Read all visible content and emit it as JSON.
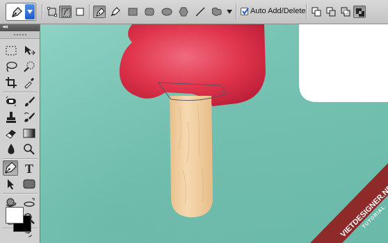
{
  "options_bar": {
    "tool_preset_icon": "pen-icon",
    "tool_icons": [
      "shape-layers-icon",
      "paths-icon",
      "fill-pixels-icon",
      "pen-icon",
      "freeform-pen-icon",
      "rectangle-icon",
      "rounded-rectangle-icon",
      "ellipse-icon",
      "polygon-icon",
      "line-icon",
      "custom-shape-icon",
      "dropdown-arrow-icon"
    ],
    "auto_add_delete": {
      "label": "Auto Add/Delete",
      "checked": true
    },
    "path_mode_icons": [
      "add-to-path-icon",
      "subtract-from-path-icon",
      "intersect-path-icon",
      "exclude-overlap-icon"
    ]
  },
  "toolbox": {
    "header_glyph": "◂◂",
    "tools": [
      "marquee-icon",
      "move-icon",
      "lasso-icon",
      "quick-selection-icon",
      "crop-icon",
      "eyedropper-icon",
      "spot-healing-icon",
      "brush-icon",
      "clone-stamp-icon",
      "history-brush-icon",
      "eraser-icon",
      "gradient-icon",
      "blur-icon",
      "dodge-icon",
      "pen-icon",
      "type-icon",
      "path-selection-icon",
      "rounded-rectangle-icon",
      "3d-rotate-icon",
      "3d-orbit-icon",
      "hand-icon",
      "zoom-icon"
    ],
    "foreground_color": "#ffffff",
    "background_color": "#000000"
  },
  "canvas": {
    "background_color": "#7fc9b9",
    "popsicle_color": "#e0344c",
    "stick_color": "#f2cfa0"
  },
  "watermark": {
    "site": "VIETDESIGNER.NET",
    "tag": "TUTORIAL",
    "ribbon_color": "#8e2a2a"
  }
}
